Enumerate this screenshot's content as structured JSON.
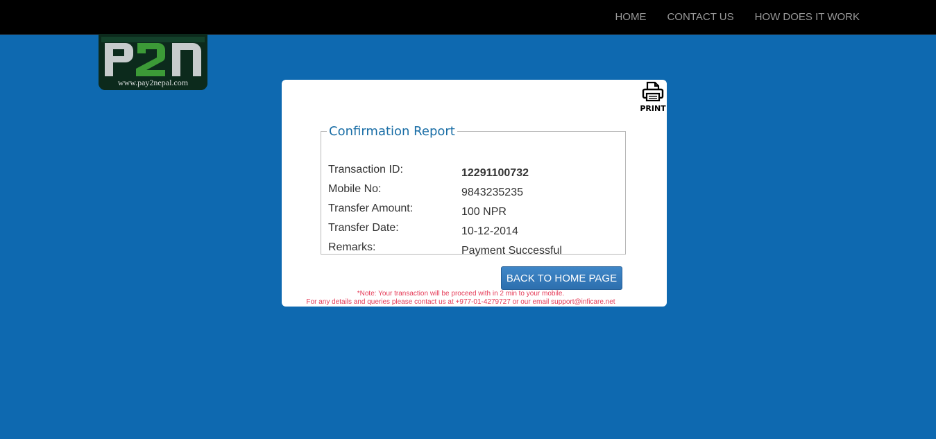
{
  "nav": {
    "items": [
      {
        "label": "HOME"
      },
      {
        "label": "CONTACT US"
      },
      {
        "label": "HOW DOES IT WORK"
      }
    ]
  },
  "logo": {
    "mark": "P2N",
    "url_text": "www.pay2nepal.com"
  },
  "print": {
    "label": "PRINT",
    "icon": "printer-icon"
  },
  "report": {
    "title": "Confirmation Report",
    "fields": [
      {
        "label": "Transaction ID:",
        "value": "12291100732"
      },
      {
        "label": "Mobile No:",
        "value": "9843235235"
      },
      {
        "label": "Transfer Amount:",
        "value": "100 NPR"
      },
      {
        "label": "Transfer Date:",
        "value": "10-12-2014"
      },
      {
        "label": "Remarks:",
        "value": "Payment Successful"
      }
    ]
  },
  "back_button": {
    "label": "BACK TO HOME PAGE"
  },
  "notes": {
    "line1": "*Note: Your transaction will be proceed with in 2 min to your mobile.",
    "line2": "For any details and queries please contact us at +977-01-4279727 or our email support@inficare.net"
  },
  "colors": {
    "page_background": "#0e69b0",
    "navbar": "#000000",
    "legend": "#1a6ea6",
    "button": "#337ab7",
    "note": "#e53a57"
  }
}
